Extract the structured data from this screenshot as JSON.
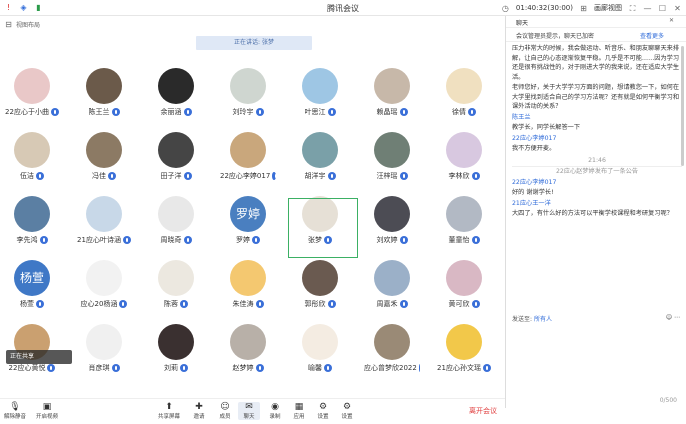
{
  "window": {
    "title": "腾讯会议",
    "meeting_time": "01:40:32(30:00)",
    "view_label": "画廊视图",
    "layout_icon": "grid-icon"
  },
  "subtop": {
    "label": "视图布局"
  },
  "speaker": "正在讲话: 张梦",
  "participants": [
    {
      "name": "22应心于小曲",
      "color": "#e9c8c8",
      "text": ""
    },
    {
      "name": "陈王兰",
      "color": "#6b5a4a",
      "text": ""
    },
    {
      "name": "余丽涵",
      "color": "#2a2a2a",
      "text": ""
    },
    {
      "name": "刘玲宇",
      "color": "#cfd6d0",
      "text": ""
    },
    {
      "name": "叶思江",
      "color": "#9ec6e4",
      "text": ""
    },
    {
      "name": "赖晶瑶",
      "color": "#c7b8a9",
      "text": ""
    },
    {
      "name": "徐倩",
      "color": "#f0e0c0",
      "text": ""
    },
    {
      "name": "伍洁",
      "color": "#d7c9b5",
      "text": ""
    },
    {
      "name": "冯佳",
      "color": "#8c7a64",
      "text": ""
    },
    {
      "name": "田子洋",
      "color": "#454545",
      "text": ""
    },
    {
      "name": "22应心李婷017",
      "color": "#c9a77c",
      "text": ""
    },
    {
      "name": "胡洋宇",
      "color": "#7aa0a8",
      "text": ""
    },
    {
      "name": "汪梓瑶",
      "color": "#6f7f75",
      "text": ""
    },
    {
      "name": "李林欣",
      "color": "#d8c8e0",
      "text": ""
    },
    {
      "name": "李先鸿",
      "color": "#5b7fa3",
      "text": ""
    },
    {
      "name": "21应心叶诗涵",
      "color": "#c8d8e8",
      "text": ""
    },
    {
      "name": "周晓奇",
      "color": "#e8e8e8",
      "text": ""
    },
    {
      "name": "罗婷",
      "color": "#4a7fc0",
      "text": "罗婷"
    },
    {
      "name": "张梦",
      "color": "#e6e0d6",
      "text": ""
    },
    {
      "name": "刘欢婷",
      "color": "#4c4c54",
      "text": ""
    },
    {
      "name": "董童怡",
      "color": "#b2b9c4",
      "text": ""
    },
    {
      "name": "杨萱",
      "color": "#3f78c6",
      "text": "杨萱"
    },
    {
      "name": "应心20杨涵",
      "color": "#f2f2f2",
      "text": ""
    },
    {
      "name": "陈蓉",
      "color": "#ece8e0",
      "text": ""
    },
    {
      "name": "朱佳涛",
      "color": "#f4c870",
      "text": ""
    },
    {
      "name": "郭彤欣",
      "color": "#6a5a50",
      "text": ""
    },
    {
      "name": "周嘉禾",
      "color": "#9bb0c8",
      "text": ""
    },
    {
      "name": "黄可欣",
      "color": "#d9b8c4",
      "text": ""
    },
    {
      "name": "22应心黄悦",
      "color": "#caa070",
      "text": ""
    },
    {
      "name": "肖彦琪",
      "color": "#f0f0f0",
      "text": ""
    },
    {
      "name": "刘莉",
      "color": "#3a3030",
      "text": ""
    },
    {
      "name": "赵梦婷",
      "color": "#b8b0a8",
      "text": ""
    },
    {
      "name": "喻馨",
      "color": "#f4ece2",
      "text": ""
    },
    {
      "name": "应心曾梦欣2022",
      "color": "#9a8a76",
      "text": ""
    },
    {
      "name": "21应心孙文瑶",
      "color": "#f2c84a",
      "text": ""
    }
  ],
  "share_indicator": "正在共享",
  "toolbar": [
    {
      "label": "解除静音",
      "icon": "mic-off-icon"
    },
    {
      "label": "开启视频",
      "icon": "camera-off-icon"
    },
    {
      "label": "共享屏幕",
      "icon": "share-screen-icon"
    },
    {
      "label": "邀请",
      "icon": "invite-icon"
    },
    {
      "label": "成员",
      "icon": "members-icon"
    },
    {
      "label": "聊天",
      "icon": "chat-icon"
    },
    {
      "label": "录制",
      "icon": "record-icon"
    },
    {
      "label": "应用",
      "icon": "apps-icon"
    },
    {
      "label": "设置",
      "icon": "settings-icon"
    }
  ],
  "leave_label": "离开会议",
  "panel": {
    "title": "聊天",
    "notice": "会议管理员提示，聊天已加密",
    "notice_link": "查看更多",
    "messages": [
      "压力非常大的时候，我会做运动、听音乐、和朋友聊聊天来排解，让自己的心态逐渐恢复平稳。几乎是不可能……因为学习还是很有挑战性的，对于刚进大学的我来说，还在适应大学生活。",
      "老师您好，关于大学学习方面的问题，想请教您一下，如何在大学里找到适合自己的学习方法呢？还有就是如何平衡学习和课外活动的关系？",
      "陈王兰",
      "教学长，同学长解答一下",
      "22应心李婷017",
      "我不方便开麦。",
      "21:46",
      "22应心赵梦婷发布了一条公告",
      "22应心李婷017",
      "好的 谢谢学长!",
      "21应心王一洋",
      "大四了，有什么好的方法可以平衡学校课程和考研复习呢？"
    ],
    "send_to_label": "发送至:",
    "send_to_target": "所有人",
    "count": "0/500"
  }
}
